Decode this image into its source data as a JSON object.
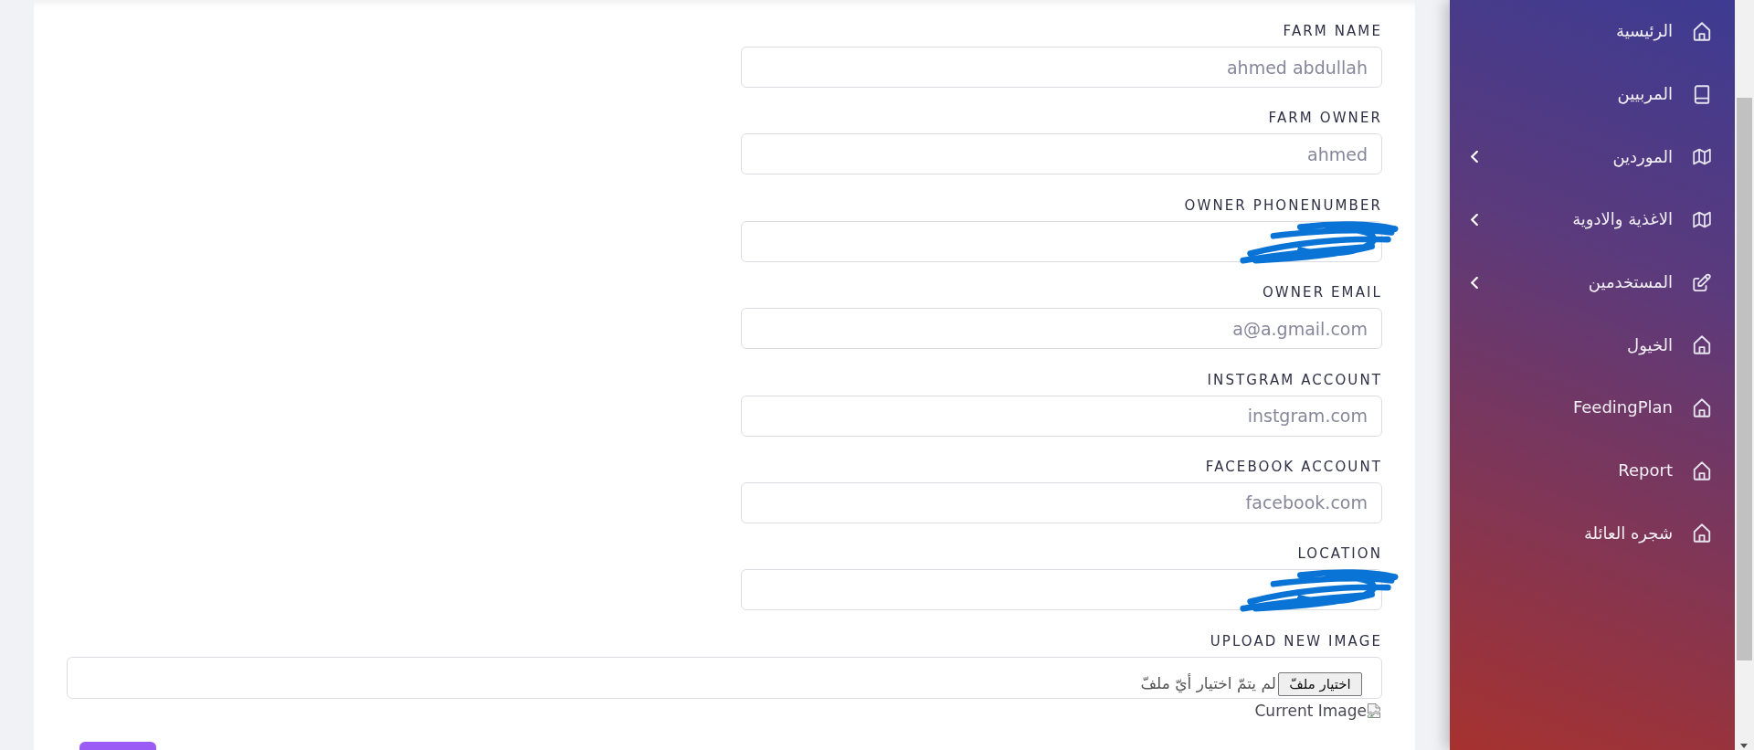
{
  "form": {
    "fields": [
      {
        "label": "FARM NAME",
        "value": "ahmed abdullah",
        "redacted": false
      },
      {
        "label": "FARM OWNER",
        "value": "ahmed",
        "redacted": false
      },
      {
        "label": "OWNER PHONENUMBER",
        "redacted": true
      },
      {
        "label": "OWNER EMAIL",
        "value": "a@a.gmail.com",
        "redacted": false
      },
      {
        "label": "INSTGRAM ACCOUNT",
        "value": "instgram.com",
        "redacted": false
      },
      {
        "label": "FACEBOOK ACCOUNT",
        "value": "facebook.com",
        "redacted": false
      },
      {
        "label": "LOCATION",
        "redacted": true
      }
    ],
    "upload": {
      "label": "UPLOAD NEW IMAGE",
      "button": "اختيار ملفّ",
      "status": "لم يتمّ اختيار أيّ ملفّ"
    },
    "current_image": {
      "alt": "Current Image"
    }
  },
  "sidebar": {
    "items": [
      {
        "label": "الرئيسية",
        "kind": "home",
        "has_submenu": false
      },
      {
        "label": "المربيين",
        "kind": "book",
        "has_submenu": false
      },
      {
        "label": "الموردين",
        "kind": "map",
        "has_submenu": true
      },
      {
        "label": "الاغذية والادوية",
        "kind": "map",
        "has_submenu": true
      },
      {
        "label": "المستخدمين",
        "kind": "edit",
        "has_submenu": true
      },
      {
        "label": "الخيول",
        "kind": "home",
        "has_submenu": false
      },
      {
        "label": "FeedingPlan",
        "kind": "home",
        "has_submenu": false
      },
      {
        "label": "Report",
        "kind": "home",
        "has_submenu": false
      },
      {
        "label": "شجره العائلة",
        "kind": "home",
        "has_submenu": false
      }
    ]
  }
}
